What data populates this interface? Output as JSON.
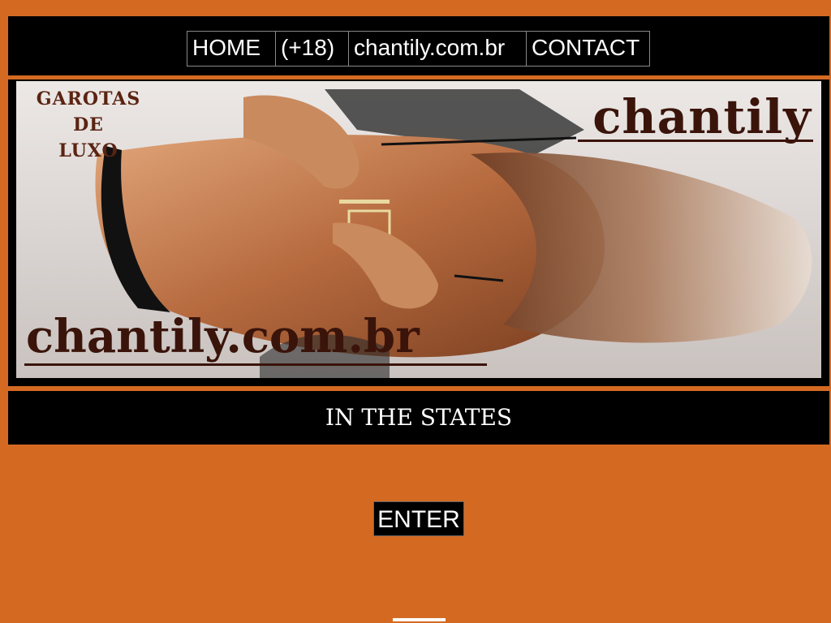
{
  "nav": {
    "items": [
      {
        "label": "HOME"
      },
      {
        "label": "(+18)"
      },
      {
        "label": "chantily.com.br"
      },
      {
        "label": "CONTACT"
      }
    ]
  },
  "banner": {
    "brand_top": "chantily",
    "tagline_line1": "GAROTAS DE",
    "tagline_line2": "LUXO",
    "brand_bottom": "chantily.com.br"
  },
  "section": {
    "title": "IN THE STATES"
  },
  "enter": {
    "label": "ENTER"
  },
  "colors": {
    "background": "#d46a22",
    "bar": "#000000",
    "brand_text": "#3a140a"
  }
}
